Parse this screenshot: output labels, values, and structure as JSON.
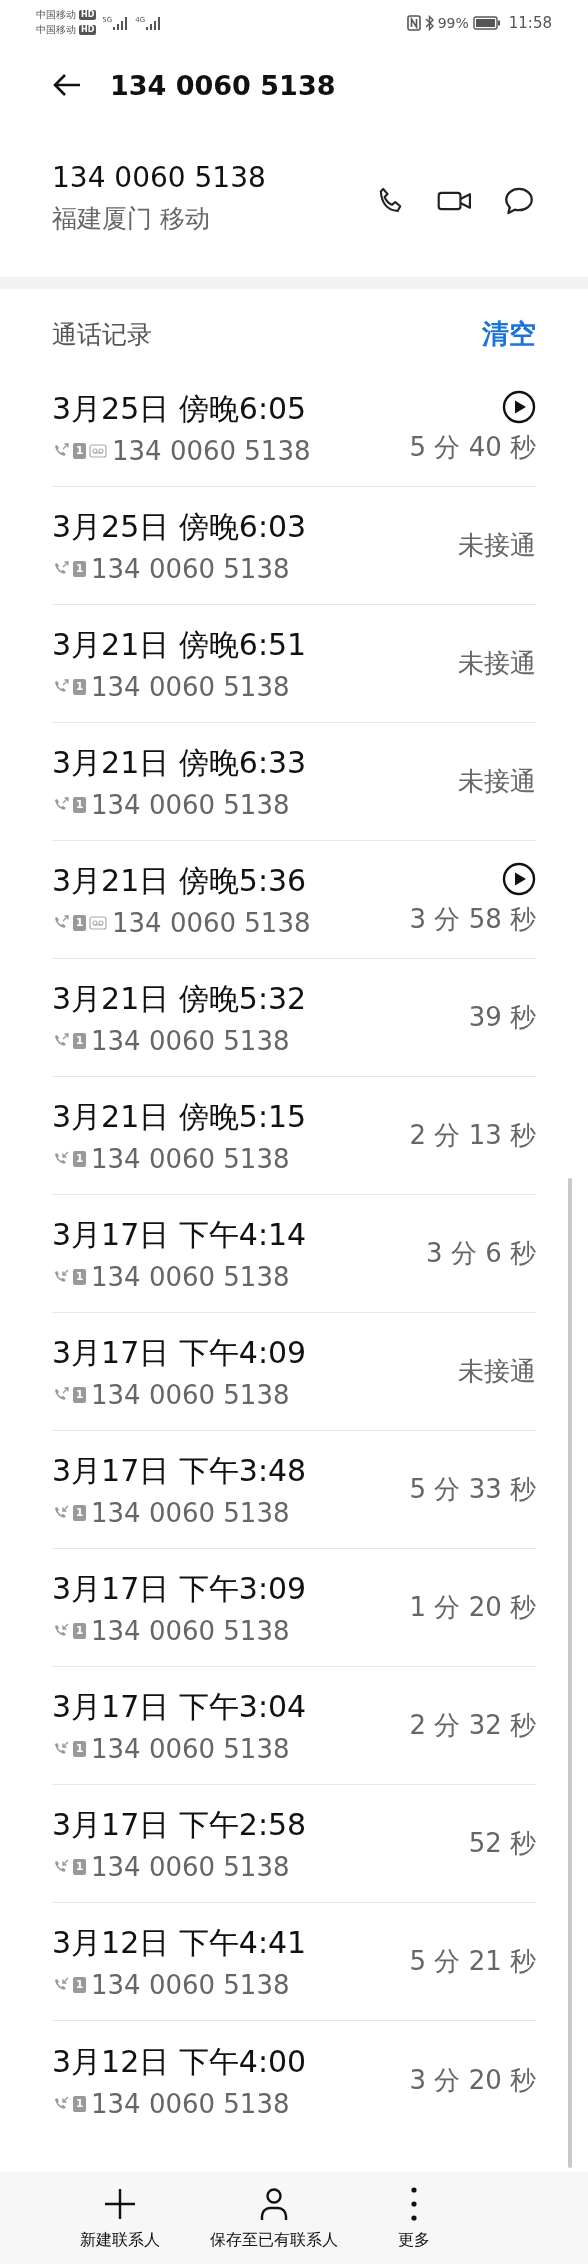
{
  "status_bar": {
    "carriers": [
      {
        "name": "中国移动",
        "badge": "HD",
        "network": "5G"
      },
      {
        "name": "中国移动",
        "badge": "HD",
        "network": "4G"
      }
    ],
    "battery": "99%",
    "time": "11:58"
  },
  "header": {
    "title": "134 0060 5138"
  },
  "contact": {
    "number": "134 0060 5138",
    "location": "福建厦门 移动"
  },
  "history": {
    "title": "通话记录",
    "clear": "清空",
    "rows": [
      {
        "time": "3月25日 傍晚6:05",
        "kind": "outgoing",
        "recorded": true,
        "sim": "1",
        "number": "134 0060 5138",
        "result": "5 分 40 秒"
      },
      {
        "time": "3月25日 傍晚6:03",
        "kind": "outgoing",
        "recorded": false,
        "sim": "1",
        "number": "134 0060 5138",
        "result": "未接通"
      },
      {
        "time": "3月21日 傍晚6:51",
        "kind": "outgoing",
        "recorded": false,
        "sim": "1",
        "number": "134 0060 5138",
        "result": "未接通"
      },
      {
        "time": "3月21日 傍晚6:33",
        "kind": "outgoing",
        "recorded": false,
        "sim": "1",
        "number": "134 0060 5138",
        "result": "未接通"
      },
      {
        "time": "3月21日 傍晚5:36",
        "kind": "outgoing",
        "recorded": true,
        "sim": "1",
        "number": "134 0060 5138",
        "result": "3 分 58 秒"
      },
      {
        "time": "3月21日 傍晚5:32",
        "kind": "outgoing",
        "recorded": false,
        "sim": "1",
        "number": "134 0060 5138",
        "result": "39 秒"
      },
      {
        "time": "3月21日 傍晚5:15",
        "kind": "incoming",
        "recorded": false,
        "sim": "1",
        "number": "134 0060 5138",
        "result": "2 分 13 秒"
      },
      {
        "time": "3月17日 下午4:14",
        "kind": "incoming",
        "recorded": false,
        "sim": "1",
        "number": "134 0060 5138",
        "result": "3 分 6 秒"
      },
      {
        "time": "3月17日 下午4:09",
        "kind": "outgoing",
        "recorded": false,
        "sim": "1",
        "number": "134 0060 5138",
        "result": "未接通"
      },
      {
        "time": "3月17日 下午3:48",
        "kind": "incoming",
        "recorded": false,
        "sim": "1",
        "number": "134 0060 5138",
        "result": "5 分 33 秒"
      },
      {
        "time": "3月17日 下午3:09",
        "kind": "incoming",
        "recorded": false,
        "sim": "1",
        "number": "134 0060 5138",
        "result": "1 分 20 秒"
      },
      {
        "time": "3月17日 下午3:04",
        "kind": "incoming",
        "recorded": false,
        "sim": "1",
        "number": "134 0060 5138",
        "result": "2 分 32 秒"
      },
      {
        "time": "3月17日 下午2:58",
        "kind": "incoming",
        "recorded": false,
        "sim": "1",
        "number": "134 0060 5138",
        "result": "52 秒"
      },
      {
        "time": "3月12日 下午4:41",
        "kind": "incoming",
        "recorded": false,
        "sim": "1",
        "number": "134 0060 5138",
        "result": "5 分 21 秒"
      },
      {
        "time": "3月12日 下午4:00",
        "kind": "incoming",
        "recorded": false,
        "sim": "1",
        "number": "134 0060 5138",
        "result": "3 分 20 秒"
      }
    ]
  },
  "bottom_bar": [
    {
      "kind": "add",
      "label": "新建联系人"
    },
    {
      "kind": "person",
      "label": "保存至已有联系人"
    },
    {
      "kind": "more",
      "label": "更多"
    }
  ]
}
